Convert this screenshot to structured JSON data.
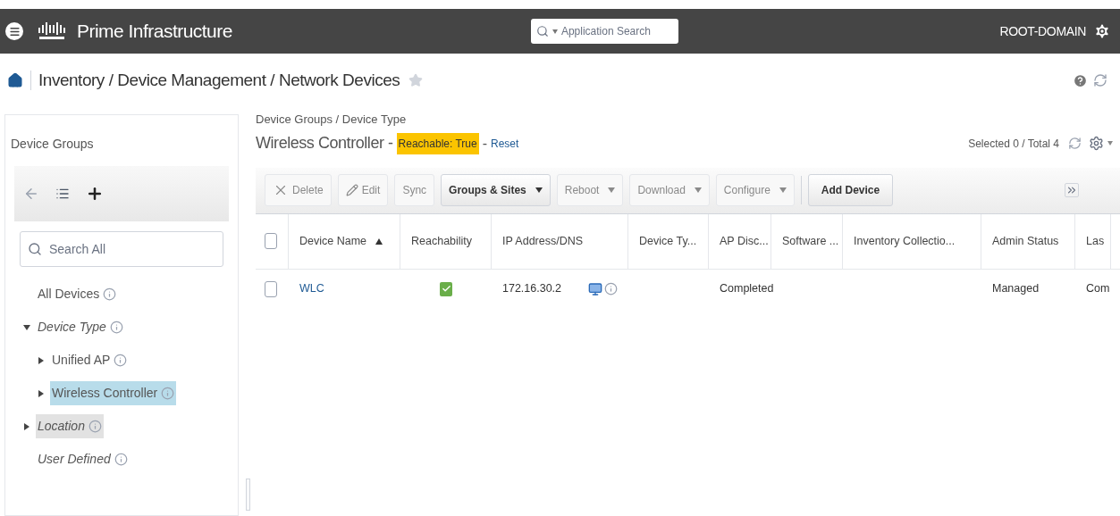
{
  "header": {
    "brand": "Prime Infrastructure",
    "search": {
      "placeholder": "Application Search"
    },
    "domain": "ROOT-DOMAIN"
  },
  "breadcrumb": {
    "text": "Inventory / Device Management / Network Devices",
    "favorite": false
  },
  "sidebar": {
    "title": "Device Groups",
    "search": {
      "placeholder": "Search All"
    },
    "tree": [
      {
        "label": "All Devices",
        "kind": "item",
        "selected": false,
        "hovered": false
      },
      {
        "label": "Device Type",
        "kind": "category",
        "expanded": true,
        "selected": false,
        "hovered": false,
        "children": [
          {
            "label": "Unified AP",
            "expanded": false,
            "selected": false
          },
          {
            "label": "Wireless Controller",
            "expanded": false,
            "selected": true
          }
        ]
      },
      {
        "label": "Location",
        "kind": "category",
        "expanded": false,
        "selected": false,
        "hovered": true
      },
      {
        "label": "User Defined",
        "kind": "category",
        "selected": false,
        "hovered": false
      }
    ]
  },
  "content": {
    "path": "Device Groups / Device Type",
    "title": "Wireless Controller -",
    "filter": "Reachable: True",
    "separator": "-",
    "reset": "Reset",
    "count": "Selected 0 / Total 4",
    "toolbar": [
      {
        "label": "Delete",
        "disabled": true,
        "has_menu": false
      },
      {
        "label": "Edit",
        "disabled": true,
        "has_menu": false
      },
      {
        "label": "Sync",
        "disabled": true,
        "has_menu": false
      },
      {
        "label": "Groups & Sites",
        "disabled": false,
        "has_menu": true
      },
      {
        "label": "Reboot",
        "disabled": true,
        "has_menu": true
      },
      {
        "label": "Download",
        "disabled": true,
        "has_menu": true
      },
      {
        "label": "Configure",
        "disabled": true,
        "has_menu": true
      },
      {
        "label": "Add Device",
        "disabled": false,
        "has_menu": false
      }
    ],
    "table": {
      "select_all": {
        "checked": false
      },
      "columns": [
        {
          "label": "Device Name",
          "sorted": true
        },
        {
          "label": "Reachability"
        },
        {
          "label": "IP Address/DNS"
        },
        {
          "label": "Device Ty..."
        },
        {
          "label": "AP Disc..."
        },
        {
          "label": "Software ..."
        },
        {
          "label": "Inventory Collectio..."
        },
        {
          "label": "Admin Status"
        },
        {
          "label": "Las"
        }
      ],
      "rows": [
        {
          "checked": false,
          "name": "WLC",
          "reachable": true,
          "ip": "172.16.30.2",
          "ap_discovery": "Completed",
          "admin_status": "Managed",
          "last": "Com"
        }
      ]
    }
  }
}
